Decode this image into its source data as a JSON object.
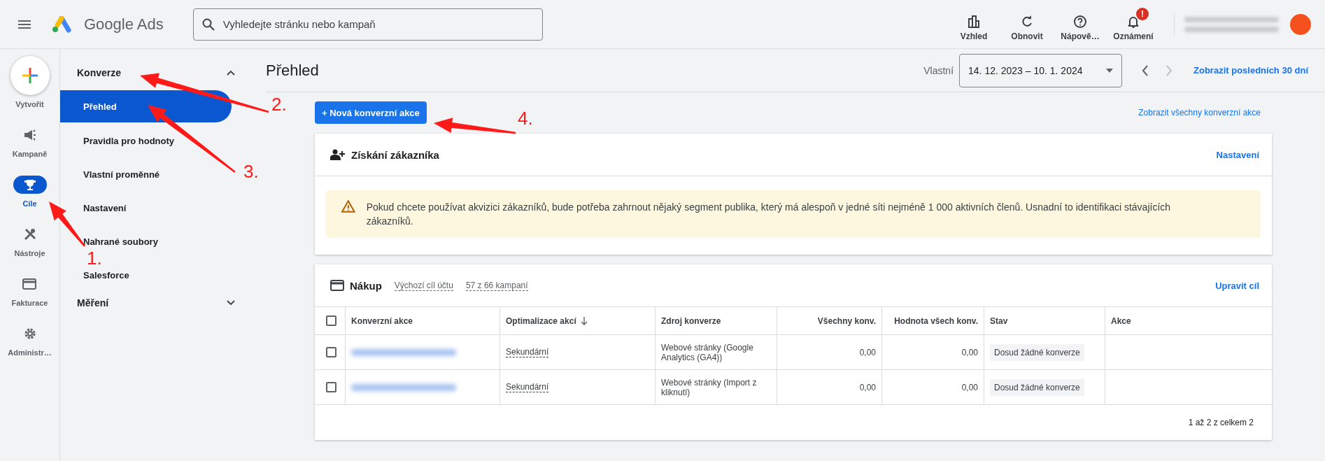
{
  "topbar": {
    "product": "Google Ads",
    "search": {
      "placeholder": "Vyhledejte stránku nebo kampaň"
    },
    "actions": [
      {
        "kind": "chart",
        "label": "Vzhled"
      },
      {
        "kind": "refresh",
        "label": "Obnovit"
      },
      {
        "kind": "help",
        "label": "Nápově…"
      },
      {
        "kind": "bell",
        "label": "Oznámení",
        "badge": "!"
      }
    ]
  },
  "rail": {
    "create": "Vytvořit",
    "items": [
      {
        "kind": "megaphone",
        "label": "Kampaně",
        "selected": false
      },
      {
        "kind": "trophy",
        "label": "Cíle",
        "selected": true
      },
      {
        "kind": "tools",
        "label": "Nástroje",
        "selected": false
      },
      {
        "kind": "card",
        "label": "Fakturace",
        "selected": false
      },
      {
        "kind": "gear",
        "label": "Administr…",
        "selected": false
      }
    ]
  },
  "nav": [
    {
      "label": "Konverze",
      "expanded": true,
      "children": [
        {
          "label": "Přehled",
          "selected": true
        },
        {
          "label": "Pravidla pro hodnoty",
          "selected": false
        },
        {
          "label": "Vlastní proměnné",
          "selected": false
        },
        {
          "label": "Nastavení",
          "selected": false
        },
        {
          "label": "Nahrané soubory",
          "selected": false
        },
        {
          "label": "Salesforce",
          "selected": false
        }
      ]
    },
    {
      "label": "Měření",
      "expanded": false
    }
  ],
  "header": {
    "title": "Přehled",
    "range_label": "Vlastní",
    "range": "14. 12. 2023 – 10. 1. 2024",
    "last30": "Zobrazit posledních 30 dní"
  },
  "new_button": "+ Nová konverzní akce",
  "view_all": "Zobrazit všechny konverzní akce",
  "acquisition": {
    "title": "Získání zákazníka",
    "link": "Nastavení",
    "warning": "Pokud chcete používat akvizici zákazníků, bude potřeba zahrnout nějaký segment publika, který má alespoň v jedné síti nejméně 1 000 aktivních členů. Usnadní to identifikaci stávajících zákazníků."
  },
  "purchase": {
    "title": "Nákup",
    "tags": [
      "Výchozí cíl účtu",
      "57 z 66 kampaní"
    ],
    "link": "Upravit cíl",
    "select_all_checked": false,
    "columns": [
      {
        "label": "Konverzní akce",
        "kind": "text",
        "sorted": false
      },
      {
        "label": "Optimalizace akcí",
        "kind": "text",
        "sorted": true
      },
      {
        "label": "Zdroj konverze",
        "kind": "text",
        "sorted": false
      },
      {
        "label": "Všechny konv.",
        "kind": "number",
        "sorted": false
      },
      {
        "label": "Hodnota všech konv.",
        "kind": "number",
        "sorted": false
      },
      {
        "label": "Stav",
        "kind": "text",
        "sorted": false
      },
      {
        "label": "Akce",
        "kind": "text",
        "sorted": false
      }
    ],
    "rows": [
      {
        "checked": false,
        "optimization": "Sekundární",
        "source": "Webové stránky (Google Analytics (GA4))",
        "all": "0,00",
        "value": "0,00",
        "status": "Dosud žádné konverze"
      },
      {
        "checked": false,
        "optimization": "Sekundární",
        "source": "Webové stránky (Import z kliknutí)",
        "all": "0,00",
        "value": "0,00",
        "status": "Dosud žádné konverze"
      }
    ],
    "footer": "1 až 2 z celkem 2"
  },
  "annotations": [
    {
      "label": "1."
    },
    {
      "label": "2."
    },
    {
      "label": "3."
    },
    {
      "label": "4."
    }
  ]
}
